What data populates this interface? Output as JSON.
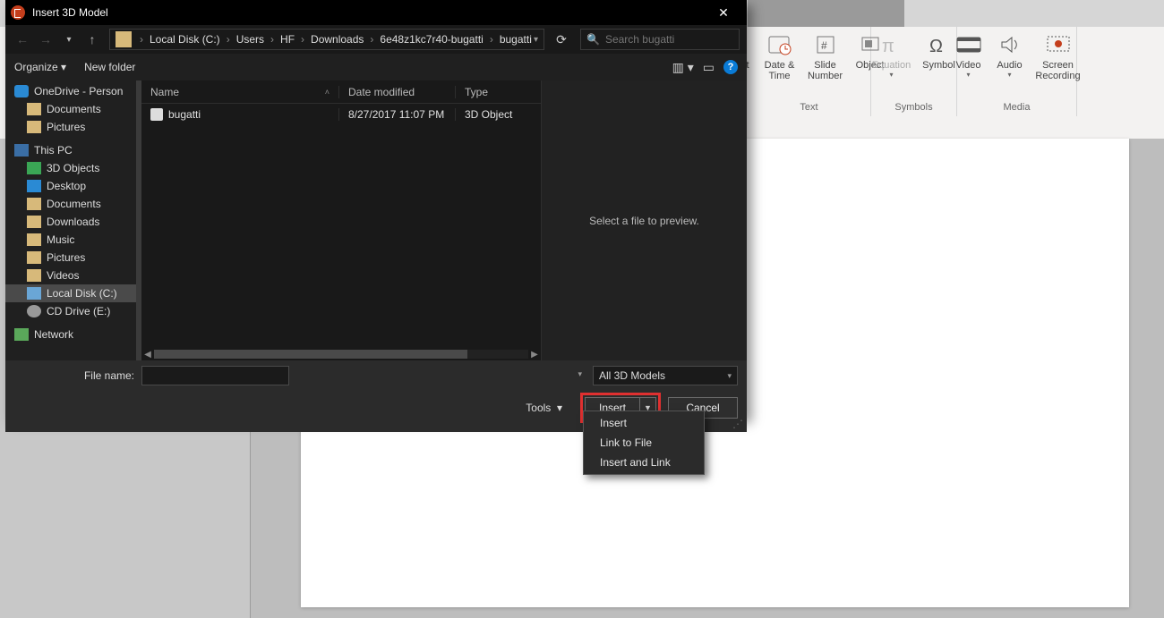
{
  "dialog": {
    "title": "Insert 3D Model",
    "breadcrumb": [
      "Local Disk (C:)",
      "Users",
      "HF",
      "Downloads",
      "6e48z1kc7r40-bugatti",
      "bugatti"
    ],
    "search_placeholder": "Search bugatti",
    "organize": "Organize",
    "new_folder": "New folder",
    "columns": {
      "name": "Name",
      "date": "Date modified",
      "type": "Type"
    },
    "files": [
      {
        "name": "bugatti",
        "date": "8/27/2017 11:07 PM",
        "type": "3D Object"
      }
    ],
    "preview_msg": "Select a file to preview.",
    "nav": {
      "onedrive": "OneDrive - Person",
      "onedrive_children": [
        "Documents",
        "Pictures"
      ],
      "thispc": "This PC",
      "thispc_children": [
        "3D Objects",
        "Desktop",
        "Documents",
        "Downloads",
        "Music",
        "Pictures",
        "Videos",
        "Local Disk (C:)",
        "CD Drive (E:)"
      ],
      "network": "Network"
    },
    "file_name_label": "File name:",
    "file_name_value": "",
    "filter": "All 3D Models",
    "tools": "Tools",
    "insert": "Insert",
    "cancel": "Cancel",
    "menu": [
      "Insert",
      "Link to File",
      "Insert and Link"
    ]
  },
  "ribbon": {
    "art": "Art",
    "dt": "Date & Time",
    "sn": "Slide Number",
    "obj": "Object",
    "eq": "Equation",
    "sym": "Symbol",
    "vid": "Video",
    "aud": "Audio",
    "scr": "Screen Recording",
    "g_text": "Text",
    "g_sym": "Symbols",
    "g_media": "Media"
  }
}
